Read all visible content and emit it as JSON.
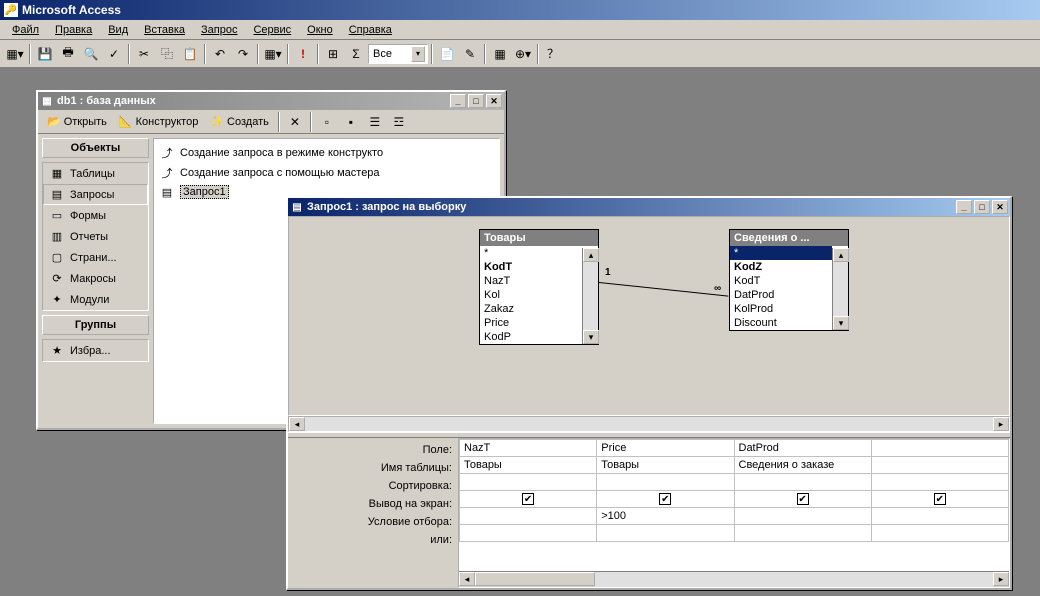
{
  "app": {
    "title": "Microsoft Access"
  },
  "menu": [
    "Файл",
    "Правка",
    "Вид",
    "Вставка",
    "Запрос",
    "Сервис",
    "Окно",
    "Справка"
  ],
  "toolbar": {
    "combo_value": "Все"
  },
  "db_window": {
    "title": "db1 : база данных",
    "tb": {
      "open": "Открыть",
      "design": "Конструктор",
      "new": "Создать"
    },
    "side": {
      "objects_hdr": "Объекты",
      "items": [
        {
          "icon": "▦",
          "label": "Таблицы"
        },
        {
          "icon": "▤",
          "label": "Запросы"
        },
        {
          "icon": "▭",
          "label": "Формы"
        },
        {
          "icon": "▥",
          "label": "Отчеты"
        },
        {
          "icon": "▢",
          "label": "Страни..."
        },
        {
          "icon": "⟳",
          "label": "Макросы"
        },
        {
          "icon": "✦",
          "label": "Модули"
        }
      ],
      "groups_hdr": "Группы",
      "favorites": "Избра..."
    },
    "list": [
      {
        "icon": "⤴",
        "label": "Создание запроса в режиме конструкто"
      },
      {
        "icon": "⤴",
        "label": "Создание запроса с помощью мастера"
      },
      {
        "icon": "▤",
        "label": "Запрос1"
      }
    ]
  },
  "query_window": {
    "title": "Запрос1 : запрос на выборку",
    "tables": [
      {
        "name": "Товары",
        "fields": [
          "*",
          "KodT",
          "NazT",
          "Kol",
          "Zakaz",
          "Price",
          "KodP"
        ],
        "pk": 1,
        "selected": -1
      },
      {
        "name": "Сведения о ...",
        "fields": [
          "*",
          "KodZ",
          "KodT",
          "DatProd",
          "KolProd",
          "Discount"
        ],
        "pk": -1,
        "selected": 0
      }
    ],
    "rel": {
      "one": "1",
      "many": "∞"
    },
    "grid_labels": [
      "Поле:",
      "Имя таблицы:",
      "Сортировка:",
      "Вывод на экран:",
      "Условие отбора:",
      "или:"
    ],
    "grid_cols": [
      {
        "field": "NazT",
        "table": "Товары",
        "sort": "",
        "show": true,
        "criteria": "",
        "or": ""
      },
      {
        "field": "Price",
        "table": "Товары",
        "sort": "",
        "show": true,
        "criteria": ">100",
        "or": ""
      },
      {
        "field": "DatProd",
        "table": "Сведения о заказе",
        "sort": "",
        "show": true,
        "criteria": "",
        "or": ""
      },
      {
        "field": "",
        "table": "",
        "sort": "",
        "show": true,
        "criteria": "",
        "or": ""
      }
    ]
  }
}
